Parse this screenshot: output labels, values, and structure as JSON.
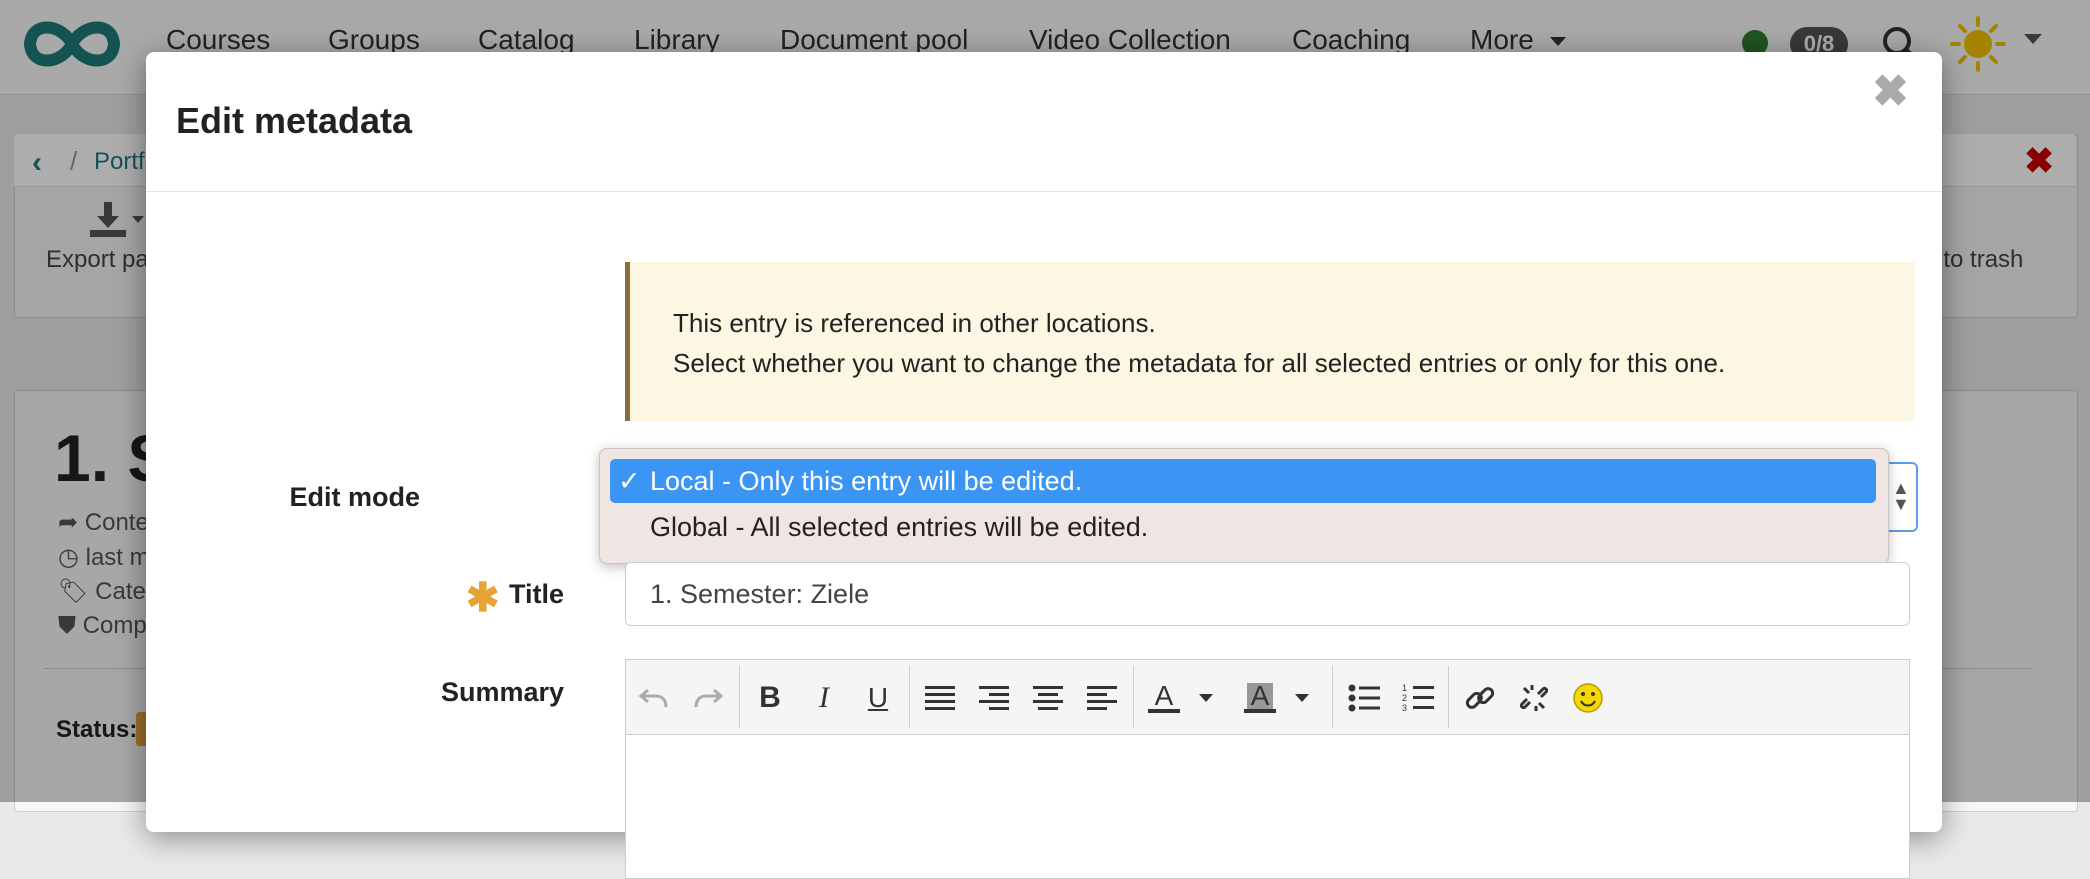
{
  "navbar": {
    "items": [
      "Courses",
      "Groups",
      "Catalog",
      "Library",
      "Document pool",
      "Video Collection",
      "Coaching",
      "More"
    ],
    "badge": "0/8"
  },
  "background": {
    "breadcrumb_item": "Portf",
    "export_label": "Export pa",
    "trash_label": "nto trash",
    "content_title": "1. S",
    "meta_lines": [
      "Conte",
      "last m",
      "Categ",
      "Comp"
    ],
    "status_label": "Status:"
  },
  "modal": {
    "title": "Edit metadata",
    "alert_lines": [
      "This entry is referenced in other locations.",
      "Select whether you want to change the metadata for all selected entries or only for this one."
    ],
    "edit_mode_label": "Edit mode",
    "edit_mode_options": [
      {
        "label": "Local - Only this entry will be edited.",
        "selected": true
      },
      {
        "label": "Global - All selected entries will be edited.",
        "selected": false
      }
    ],
    "title_label": "Title",
    "title_value": "1. Semester: Ziele",
    "summary_label": "Summary",
    "editor_icons": [
      "undo-icon",
      "redo-icon",
      "bold-icon",
      "italic-icon",
      "underline-icon",
      "align-justify-icon",
      "align-right-icon",
      "align-center-icon",
      "align-left-icon",
      "text-color-icon",
      "background-color-icon",
      "bullet-list-icon",
      "numbered-list-icon",
      "link-icon",
      "unlink-icon",
      "emoticon-icon"
    ]
  },
  "colors": {
    "accent_teal": "#1d7b79",
    "selected_option": "#3b95f5",
    "alert_bg": "#fcf7e3",
    "required_star": "#e8a235"
  }
}
